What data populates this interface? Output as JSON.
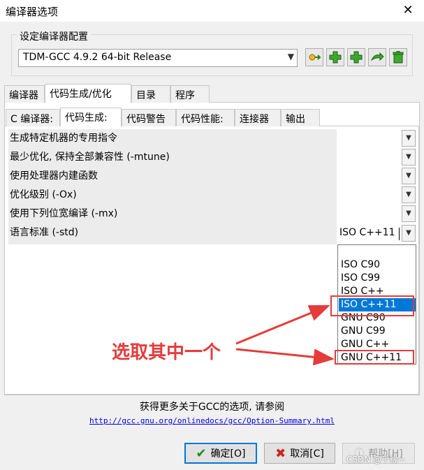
{
  "window": {
    "title": "编译器选项",
    "close": "✕"
  },
  "config": {
    "group_label": "设定编译器配置",
    "selected_profile": "TDM-GCC 4.9.2 64-bit Release",
    "toolbar_icons": [
      "edit-config-icon",
      "add-config-icon",
      "add-new-config-icon",
      "rename-config-icon",
      "delete-config-icon"
    ]
  },
  "main_tabs": [
    {
      "label": "编译器"
    },
    {
      "label": "代码生成/优化"
    },
    {
      "label": "目录"
    },
    {
      "label": "程序"
    }
  ],
  "sub_tabs": [
    {
      "label": "C 编译器:"
    },
    {
      "label": "代码生成:"
    },
    {
      "label": "代码警告"
    },
    {
      "label": "代码性能:"
    },
    {
      "label": "连接器"
    },
    {
      "label": "输出"
    }
  ],
  "options": [
    {
      "label": "生成特定机器的专用指令"
    },
    {
      "label": "最少优化, 保持全部兼容性 (-mtune)"
    },
    {
      "label": "使用处理器内建函数"
    },
    {
      "label": "优化级别 (-Ox)"
    },
    {
      "label": "使用下列位宽编译 (-mx)"
    },
    {
      "label": "语言标准 (-std)",
      "value": "ISO C++11"
    }
  ],
  "std_dropdown": {
    "items": [
      "",
      "ISO C90",
      "ISO C99",
      "ISO C++",
      "ISO C++11",
      "GNU C90",
      "GNU C99",
      "GNU C++",
      "GNU C++11"
    ],
    "selected": "ISO C++11"
  },
  "annotation": {
    "text": "选取其中一个",
    "color": "#e53b3b"
  },
  "footer": {
    "info": "获得更多关于GCC的选项, 请参阅",
    "link": "http://gcc.gnu.org/onlinedocs/gcc/Option-Summary.html"
  },
  "buttons": {
    "ok": "确定[O]",
    "cancel": "取消[C]",
    "help": "帮助[H]"
  },
  "watermark": "CSDN @千缘~",
  "colors": {
    "selection": "#0078d7",
    "annotation": "#e53b3b",
    "ok_check": "#1e8a1e",
    "cancel_x": "#d02020"
  }
}
